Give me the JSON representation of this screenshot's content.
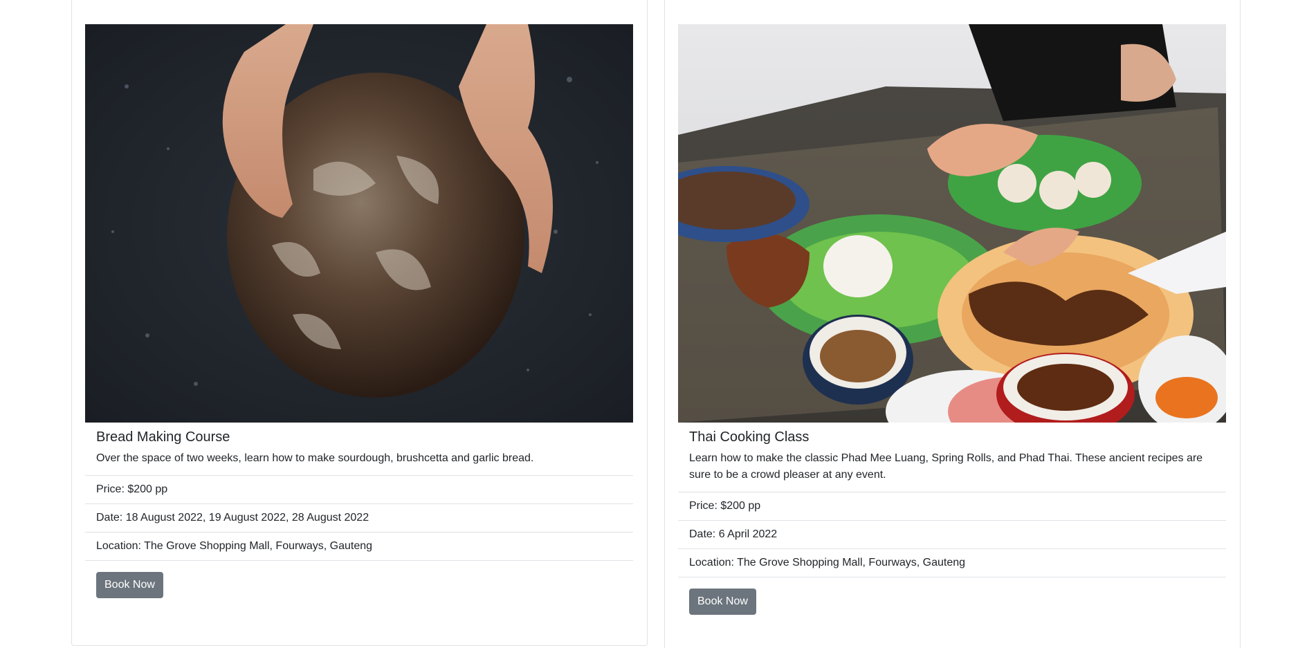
{
  "cards": [
    {
      "image_alt": "Hands holding a round sourdough loaf",
      "title": "Bread Making Course",
      "description": "Over the space of two weeks, learn how to make sourdough, brushcetta and garlic bread.",
      "price": "Price: $200 pp",
      "date": "Date: 18 August 2022, 19 August 2022, 28 August 2022",
      "location": "Location: The Grove Shopping Mall, Fourways, Gauteng",
      "button_label": "Book Now"
    },
    {
      "image_alt": "Table of Thai dishes with chopsticks",
      "title": "Thai Cooking Class",
      "description": "Learn how to make the classic Phad Mee Luang, Spring Rolls, and Phad Thai. These ancient recipes are sure to be a crowd pleaser at any event.",
      "price": "Price: $200 pp",
      "date": "Date: 6 April 2022",
      "location": "Location: The Grove Shopping Mall, Fourways, Gauteng",
      "button_label": "Book Now"
    }
  ],
  "colors": {
    "button_bg": "#6c757d",
    "border": "#dfe2e6",
    "text": "#212529"
  }
}
